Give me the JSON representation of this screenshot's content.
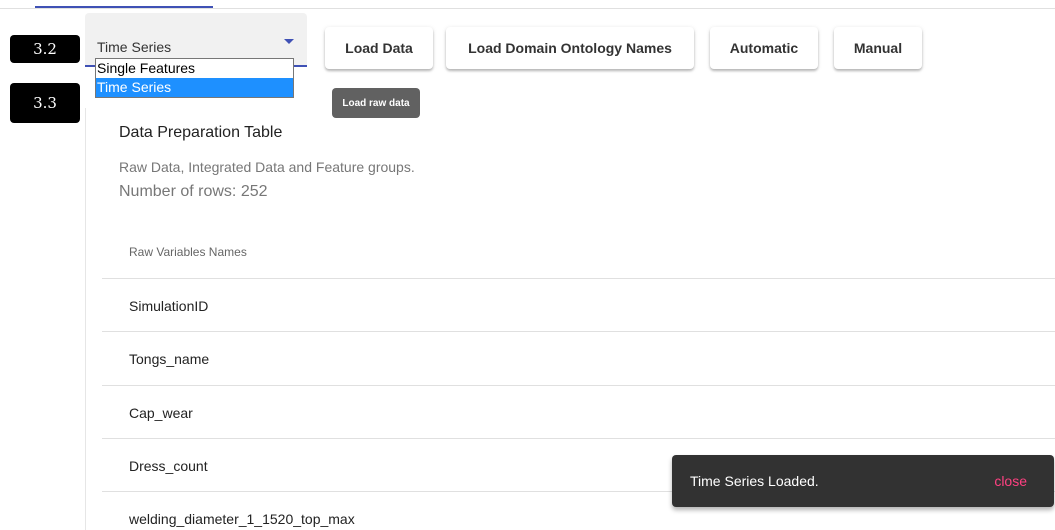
{
  "badges": {
    "step_select": "3.2",
    "step_option": "3.3"
  },
  "mode_select": {
    "value": "Time Series",
    "options": [
      {
        "label": "Single Features",
        "selected": false
      },
      {
        "label": "Time Series",
        "selected": true
      }
    ]
  },
  "toolbar": {
    "load_data": "Load Data",
    "load_ontology": "Load Domain Ontology Names",
    "automatic": "Automatic",
    "manual": "Manual"
  },
  "tooltip": {
    "text": "Load raw data"
  },
  "card": {
    "title": "Data Preparation Table",
    "subtitle": "Raw Data, Integrated Data and Feature groups.",
    "rows_label": "Number of rows:",
    "rows_value": "252"
  },
  "table": {
    "header": "Raw Variables Names",
    "rows": [
      "SimulationID",
      "Tongs_name",
      "Cap_wear",
      "Dress_count",
      "welding_diameter_1_1520_top_max"
    ]
  },
  "snackbar": {
    "message": "Time Series Loaded.",
    "action": "close"
  },
  "colors": {
    "accent": "#3f51b5",
    "selection": "#1e90ff",
    "snackbar_bg": "#323232",
    "snackbar_action": "#ff4081"
  }
}
